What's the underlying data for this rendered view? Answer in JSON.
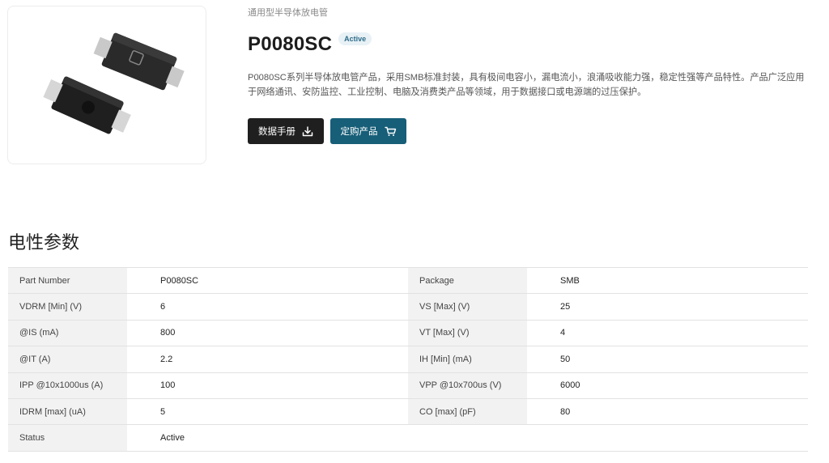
{
  "product": {
    "category": "通用型半导体放电管",
    "title": "P0080SC",
    "status_badge": "Active",
    "description": "P0080SC系列半导体放电管产品，采用SMB标准封装，具有极间电容小，漏电流小，浪涌吸收能力强，稳定性强等产品特性。产品广泛应用于网络通讯、安防监控、工业控制、电脑及消费类产品等领域，用于数据接口或电源端的过压保护。",
    "image_icon": "smb-package-photo"
  },
  "actions": {
    "datasheet_label": "数据手册",
    "datasheet_icon": "download-icon",
    "buy_label": "定购产品",
    "buy_icon": "cart-icon"
  },
  "specs": {
    "section_title": "电性参数",
    "rows": [
      {
        "k1": "Part Number",
        "v1": "P0080SC",
        "k2": "Package",
        "v2": "SMB"
      },
      {
        "k1": "VDRM [Min] (V)",
        "v1": "6",
        "k2": "VS [Max] (V)",
        "v2": "25"
      },
      {
        "k1": "@IS (mA)",
        "v1": "800",
        "k2": "VT [Max] (V)",
        "v2": "4"
      },
      {
        "k1": "@IT (A)",
        "v1": "2.2",
        "k2": "IH [Min] (mA)",
        "v2": "50"
      },
      {
        "k1": "IPP @10x1000us (A)",
        "v1": "100",
        "k2": "VPP @10x700us (V)",
        "v2": "6000"
      },
      {
        "k1": "IDRM [max] (uA)",
        "v1": "5",
        "k2": "CO [max] (pF)",
        "v2": "80"
      },
      {
        "k1": "Status",
        "v1": "Active",
        "k2": "",
        "v2": ""
      }
    ]
  },
  "colors": {
    "datasheet_button": "#1f1f1f",
    "buy_button": "#175e78",
    "key_cell_bg": "#f2f2f2"
  }
}
